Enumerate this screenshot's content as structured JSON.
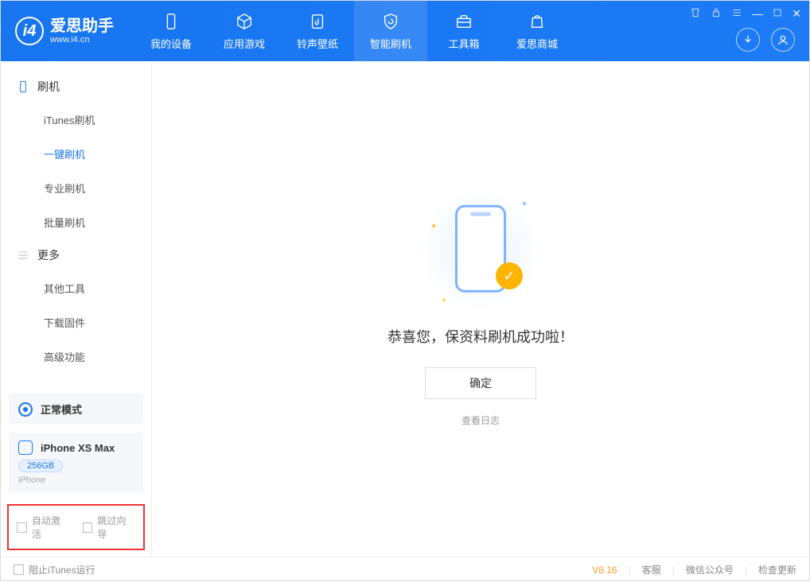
{
  "app": {
    "title": "爱思助手",
    "subtitle": "www.i4.cn"
  },
  "tabs": [
    {
      "label": "我的设备"
    },
    {
      "label": "应用游戏"
    },
    {
      "label": "铃声壁纸"
    },
    {
      "label": "智能刷机"
    },
    {
      "label": "工具箱"
    },
    {
      "label": "爱思商城"
    }
  ],
  "sidebar": {
    "section_flash": "刷机",
    "items_flash": [
      {
        "label": "iTunes刷机"
      },
      {
        "label": "一键刷机"
      },
      {
        "label": "专业刷机"
      },
      {
        "label": "批量刷机"
      }
    ],
    "section_more": "更多",
    "items_more": [
      {
        "label": "其他工具"
      },
      {
        "label": "下载固件"
      },
      {
        "label": "高级功能"
      }
    ]
  },
  "mode_card": {
    "label": "正常模式"
  },
  "device_card": {
    "name": "iPhone XS Max",
    "storage": "256GB",
    "type": "iPhone"
  },
  "bottom_checks": {
    "auto_activate": "自动激活",
    "skip_guide": "跳过向导"
  },
  "main": {
    "success": "恭喜您，保资料刷机成功啦！",
    "ok_btn": "确定",
    "view_log": "查看日志"
  },
  "footer": {
    "block_itunes": "阻止iTunes运行",
    "version": "V8.16",
    "links": {
      "service": "客服",
      "wechat": "微信公众号",
      "update": "检查更新"
    }
  }
}
